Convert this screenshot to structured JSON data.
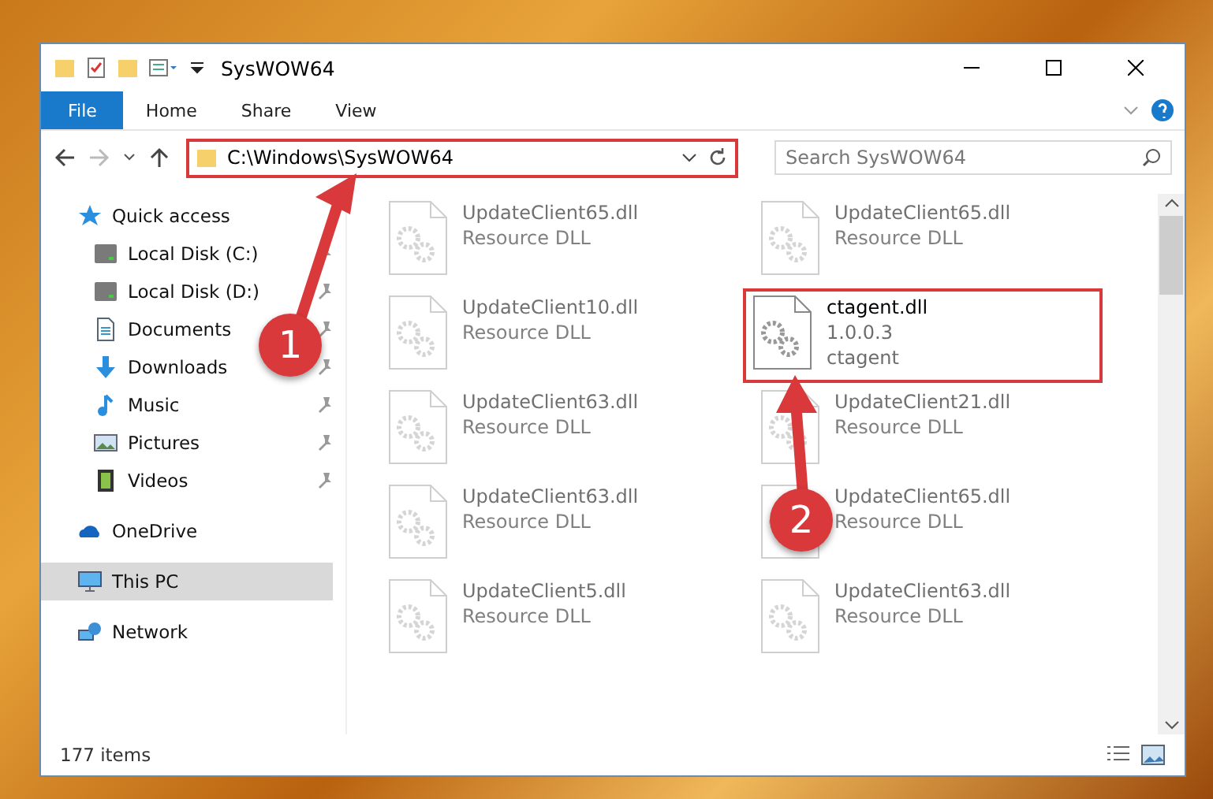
{
  "window": {
    "title": "SysWOW64"
  },
  "ribbon": {
    "tabs": [
      {
        "label": "File",
        "selected": true
      },
      {
        "label": "Home",
        "selected": false
      },
      {
        "label": "Share",
        "selected": false
      },
      {
        "label": "View",
        "selected": false
      }
    ]
  },
  "address": {
    "path": "C:\\Windows\\SysWOW64",
    "highlighted": true
  },
  "search": {
    "placeholder": "Search SysWOW64"
  },
  "nav": [
    {
      "label": "Quick access",
      "kind": "star",
      "selected": false,
      "children": [
        {
          "label": "Local Disk (C:)",
          "kind": "disk",
          "pinned": true,
          "selected": false
        },
        {
          "label": "Local Disk (D:)",
          "kind": "disk",
          "pinned": true,
          "selected": false
        },
        {
          "label": "Documents",
          "kind": "doc",
          "pinned": true,
          "selected": false
        },
        {
          "label": "Downloads",
          "kind": "download",
          "pinned": true,
          "selected": false
        },
        {
          "label": "Music",
          "kind": "music",
          "pinned": true,
          "selected": false
        },
        {
          "label": "Pictures",
          "kind": "picture",
          "pinned": true,
          "selected": false
        },
        {
          "label": "Videos",
          "kind": "video",
          "pinned": true,
          "selected": false
        }
      ]
    },
    {
      "label": "OneDrive",
      "kind": "cloud",
      "selected": false
    },
    {
      "label": "This PC",
      "kind": "pc",
      "selected": true
    },
    {
      "label": "Network",
      "kind": "network",
      "selected": false
    }
  ],
  "files": [
    {
      "name": "UpdateClient65.dll",
      "lines": [
        "Resource DLL"
      ],
      "blurred": true,
      "highlighted": false
    },
    {
      "name": "UpdateClient65.dll",
      "lines": [
        "Resource DLL"
      ],
      "blurred": true,
      "highlighted": false
    },
    {
      "name": "UpdateClient10.dll",
      "lines": [
        "Resource DLL"
      ],
      "blurred": true,
      "highlighted": false
    },
    {
      "name": "ctagent.dll",
      "lines": [
        "1.0.0.3",
        "ctagent"
      ],
      "blurred": false,
      "highlighted": true
    },
    {
      "name": "UpdateClient63.dll",
      "lines": [
        "Resource DLL"
      ],
      "blurred": true,
      "highlighted": false
    },
    {
      "name": "UpdateClient21.dll",
      "lines": [
        "Resource DLL"
      ],
      "blurred": true,
      "highlighted": false
    },
    {
      "name": "UpdateClient63.dll",
      "lines": [
        "Resource DLL"
      ],
      "blurred": true,
      "highlighted": false
    },
    {
      "name": "UpdateClient65.dll",
      "lines": [
        "Resource DLL"
      ],
      "blurred": true,
      "highlighted": false
    },
    {
      "name": "UpdateClient5.dll",
      "lines": [
        "Resource DLL"
      ],
      "blurred": true,
      "highlighted": false
    },
    {
      "name": "UpdateClient63.dll",
      "lines": [
        "Resource DLL"
      ],
      "blurred": true,
      "highlighted": false
    }
  ],
  "status_bar": {
    "count": "177 items"
  },
  "callouts": [
    {
      "label": "1"
    },
    {
      "label": "2"
    }
  ]
}
